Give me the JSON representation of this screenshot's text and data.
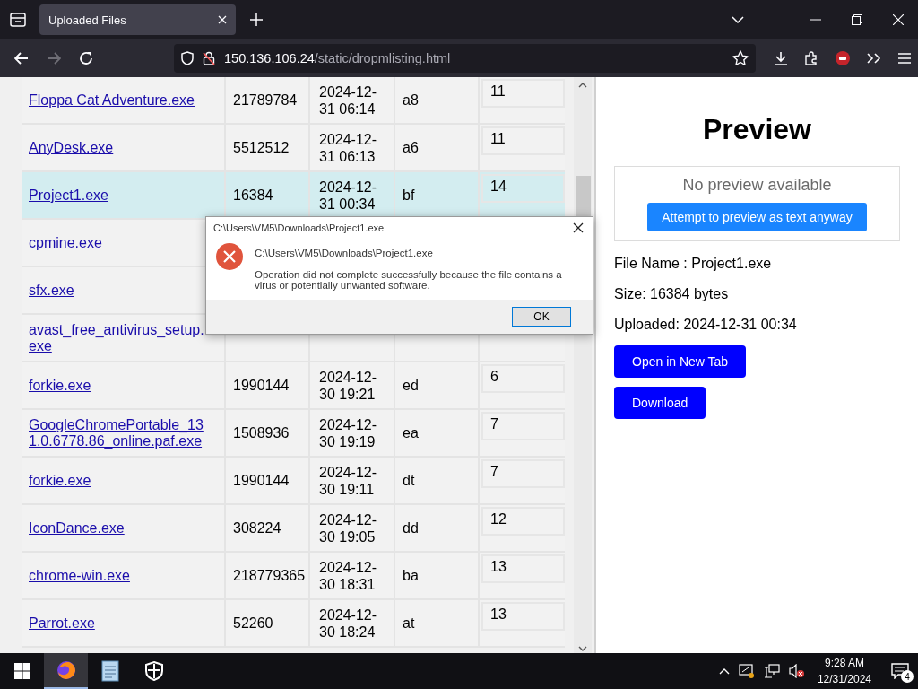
{
  "browser": {
    "tab": {
      "title": "Uploaded Files",
      "selected": true
    },
    "url": {
      "host": "150.136.106.24",
      "path": "/static/dropmlisting.html"
    }
  },
  "files": {
    "rows": [
      {
        "column_1": "Floppa Cat Adventure.exe",
        "column_2": "21789784",
        "column_3": "2024-12-31 06:14",
        "column_4": "a8",
        "column_5": "11",
        "selected": false
      },
      {
        "column_1": "AnyDesk.exe",
        "column_2": "5512512",
        "column_3": "2024-12-31 06:13",
        "column_4": "a6",
        "column_5": "11",
        "selected": false
      },
      {
        "column_1": "Project1.exe",
        "column_2": "16384",
        "column_3": "2024-12-31 00:34",
        "column_4": "bf",
        "column_5": "14",
        "selected": true
      },
      {
        "column_1": "cpmine.exe",
        "selected": false
      },
      {
        "column_1": "sfx.exe",
        "selected": false
      },
      {
        "column_1": "avast_free_antivirus_setup.exe",
        "selected": false
      },
      {
        "column_1": "forkie.exe",
        "column_2": "1990144",
        "column_3": "2024-12-30 19:21",
        "column_4": "ed",
        "column_5": "6",
        "selected": false
      },
      {
        "column_1": "GoogleChromePortable_131.0.6778.86_online.paf.exe",
        "column_2": "1508936",
        "column_3": "2024-12-30 19:19",
        "column_4": "ea",
        "column_5": "7",
        "selected": false
      },
      {
        "column_1": "forkie.exe",
        "column_2": "1990144",
        "column_3": "2024-12-30 19:11",
        "column_4": "dt",
        "column_5": "7",
        "selected": false
      },
      {
        "column_1": "IconDance.exe",
        "column_2": "308224",
        "column_3": "2024-12-30 19:05",
        "column_4": "dd",
        "column_5": "12",
        "selected": false
      },
      {
        "column_1": "chrome-win.exe",
        "column_2": "218779365",
        "column_3": "2024-12-30 18:31",
        "column_4": "ba",
        "column_5": "13",
        "selected": false
      },
      {
        "column_1": "Parrot.exe",
        "column_2": "52260",
        "column_3": "2024-12-30 18:24",
        "column_4": "at",
        "column_5": "13",
        "selected": false
      }
    ]
  },
  "preview": {
    "title": "Preview",
    "message": "No preview available",
    "preview_button": "Attempt to preview as text anyway",
    "details": [
      "File Name : Project1.exe",
      "Size: 16384 bytes",
      "Uploaded: 2024-12-31 00:34"
    ],
    "buttons": [
      "Open in New Tab",
      "Download"
    ]
  },
  "dialog": {
    "title": "C:\\Users\\VM5\\Downloads\\Project1.exe",
    "heading": "C:\\Users\\VM5\\Downloads\\Project1.exe",
    "message": "Operation did not complete successfully because the file contains a virus or potentially unwanted software.",
    "button": "OK"
  },
  "taskbar": {
    "apps": [
      {
        "kind": "browser",
        "selected": true
      },
      {
        "kind": "notepad",
        "selected": false
      },
      {
        "kind": "security",
        "selected": false
      }
    ],
    "time": "9:28 AM",
    "date": "12/31/2024",
    "notifications": "4"
  }
}
